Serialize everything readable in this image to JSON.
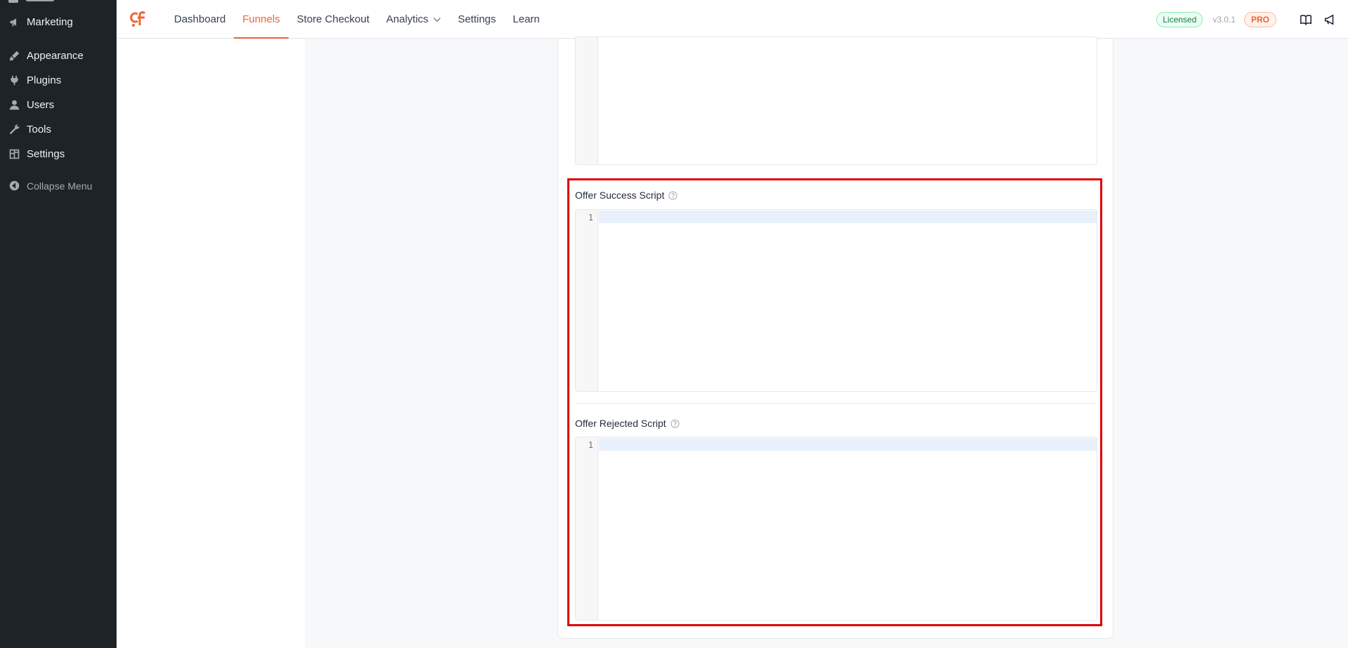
{
  "wp_menu": {
    "items": [
      {
        "label": "Marketing",
        "icon": "megaphone-icon"
      },
      {
        "label": "Appearance",
        "icon": "paintbrush-icon"
      },
      {
        "label": "Plugins",
        "icon": "plug-icon"
      },
      {
        "label": "Users",
        "icon": "user-icon"
      },
      {
        "label": "Tools",
        "icon": "wrench-icon"
      },
      {
        "label": "Settings",
        "icon": "settings-icon"
      }
    ],
    "collapse_label": "Collapse Menu"
  },
  "topnav": {
    "brand_color": "#f06335",
    "items": [
      {
        "label": "Dashboard",
        "active": false
      },
      {
        "label": "Funnels",
        "active": true
      },
      {
        "label": "Store Checkout",
        "active": false
      },
      {
        "label": "Analytics",
        "active": false,
        "has_dropdown": true
      },
      {
        "label": "Settings",
        "active": false
      },
      {
        "label": "Learn",
        "active": false
      }
    ],
    "license_badge": "Licensed",
    "version": "v3.0.1",
    "pro_badge": "PRO"
  },
  "editors": {
    "offer_success": {
      "label": "Offer Success Script",
      "line_number": "1"
    },
    "offer_rejected": {
      "label": "Offer Rejected Script",
      "line_number": "1"
    }
  },
  "colors": {
    "accent": "#f06335",
    "highlight": "#dc0000",
    "licensed": "#15803d"
  }
}
